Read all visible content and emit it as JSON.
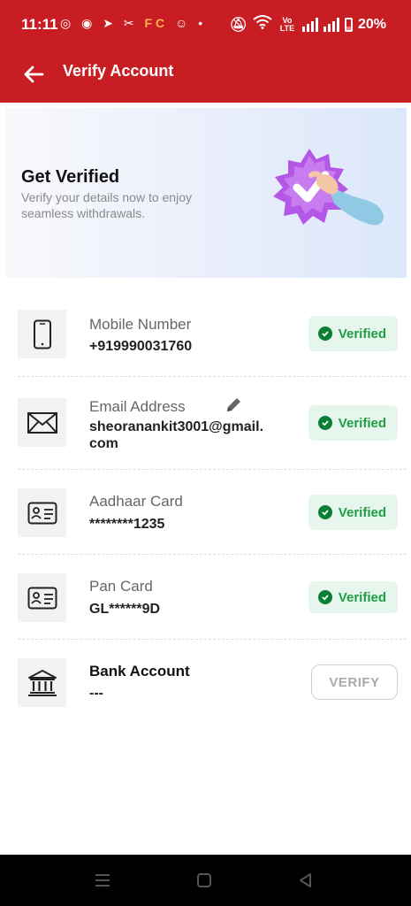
{
  "status_bar": {
    "time": "11:11",
    "network_label": "Vo LTE",
    "battery": "20%"
  },
  "header": {
    "title": "Verify Account",
    "back_icon": "arrow-left-icon"
  },
  "hero": {
    "title": "Get Verified",
    "subtitle": "Verify your details now to enjoy seamless withdrawals."
  },
  "items": [
    {
      "label": "Mobile Number",
      "value": "+919990031760",
      "status": "Verified",
      "icon": "phone-icon"
    },
    {
      "label": "Email Address",
      "value": "sheoranankit3001@gmail.com",
      "status": "Verified",
      "icon": "mail-icon"
    },
    {
      "label": "Aadhaar Card",
      "value": "********1235",
      "status": "Verified",
      "icon": "id-card-icon"
    },
    {
      "label": "Pan Card",
      "value": "GL******9D",
      "status": "Verified",
      "icon": "id-card-icon"
    },
    {
      "label": "Bank Account",
      "value": "---",
      "action": "VERIFY",
      "icon": "bank-icon"
    }
  ],
  "colors": {
    "brand": "#c91d24",
    "verified_bg": "#e7f6ec",
    "verified_text": "#1f9d45"
  }
}
